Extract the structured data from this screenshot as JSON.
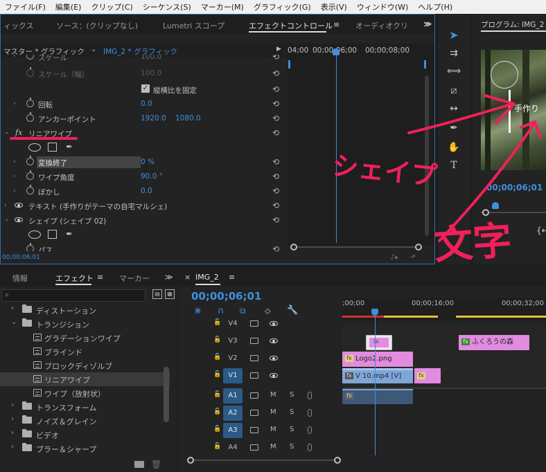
{
  "menu": [
    "ファイル(F)",
    "編集(E)",
    "クリップ(C)",
    "シーケンス(S)",
    "マーカー(M)",
    "グラフィック(G)",
    "表示(V)",
    "ウィンドウ(W)",
    "ヘルプ(H)"
  ],
  "top_panel": {
    "tabs": [
      "ィックス",
      "ソース：(クリップなし)",
      "Lumetri スコープ",
      "エフェクトコントロール",
      "オーディオクリ"
    ],
    "active_tab": "エフェクトコントロール",
    "overflow": "≫",
    "menu_icon": "≡"
  },
  "effect_controls": {
    "master_label": "マスター * グラフィック",
    "clip_label": "IMG_2 * グラフィック",
    "ruler_labels": [
      "04;00",
      "00;00;06;00",
      "00;00;08;00"
    ],
    "rows": [
      {
        "name": "スケール",
        "value": "100.0",
        "dim": true
      },
      {
        "name": "スケール（幅）",
        "value": "100.0",
        "dim": true
      },
      {
        "name": "縦横比を固定",
        "checkbox": true
      },
      {
        "name": "回転",
        "value": "0.0"
      },
      {
        "name": "アンカーポイント",
        "value": "1920.0",
        "value2": "1080.0"
      },
      {
        "name": "リニアワイプ",
        "fx": true
      },
      {
        "name": "変換終了",
        "value": "0 %",
        "highlight": true
      },
      {
        "name": "ワイプ角度",
        "value": "90.0 °"
      },
      {
        "name": "ぼかし",
        "value": "0.0"
      },
      {
        "name": "テキスト (手作りがテーマの自宅マルシェ)"
      },
      {
        "name": "シェイプ (シェイプ 02)"
      },
      {
        "name": "パス"
      }
    ],
    "timecode": "00;00;06;01"
  },
  "tools": [
    "selection-tool",
    "track-select-tool",
    "ripple-edit-tool",
    "razor-tool",
    "slip-tool",
    "pen-tool",
    "hand-tool",
    "type-tool"
  ],
  "program_monitor": {
    "title": "プログラム: IMG_2",
    "menu_icon": "≡",
    "overlay_text": "手作り",
    "timecode": "00;00;06;01"
  },
  "annotations": {
    "shape_word": "シェイプ",
    "text_word": "文字"
  },
  "effects_panel": {
    "tabs": [
      "情報",
      "エフェクト",
      "マーカー"
    ],
    "active_tab": "エフェクト",
    "menu_icon": "≡",
    "overflow": "≫",
    "tree": [
      {
        "label": "ディストーション",
        "level": 0,
        "type": "folder",
        "open": false
      },
      {
        "label": "トランジション",
        "level": 0,
        "type": "folder",
        "open": true
      },
      {
        "label": "グラデーションワイプ",
        "level": 1,
        "type": "preset"
      },
      {
        "label": "ブラインド",
        "level": 1,
        "type": "preset"
      },
      {
        "label": "ブロックディゾルブ",
        "level": 1,
        "type": "preset"
      },
      {
        "label": "リニアワイプ",
        "level": 1,
        "type": "preset",
        "selected": true
      },
      {
        "label": "ワイプ（放射状）",
        "level": 1,
        "type": "preset"
      },
      {
        "label": "トランスフォーム",
        "level": 0,
        "type": "folder",
        "open": false
      },
      {
        "label": "ノイズ＆グレイン",
        "level": 0,
        "type": "folder",
        "open": false
      },
      {
        "label": "ビデオ",
        "level": 0,
        "type": "folder",
        "open": false
      },
      {
        "label": "ブラー＆シャープ",
        "level": 0,
        "type": "folder",
        "open": false
      }
    ]
  },
  "timeline": {
    "tab_close": "×",
    "tab_label": "IMG_2",
    "menu_icon": "≡",
    "timecode": "00;00;06;01",
    "ruler_labels": [
      ";00;00",
      "00;00;16;00",
      "00;00;32;00"
    ],
    "tracks": [
      {
        "name": "V4",
        "type": "video",
        "active": false
      },
      {
        "name": "V3",
        "type": "video",
        "active": false
      },
      {
        "name": "V2",
        "type": "video",
        "active": false
      },
      {
        "name": "V1",
        "type": "video",
        "active": true
      },
      {
        "name": "A1",
        "type": "audio",
        "active": true
      },
      {
        "name": "A2",
        "type": "audio",
        "active": true
      },
      {
        "name": "A3",
        "type": "audio",
        "active": true
      },
      {
        "name": "A4",
        "type": "audio",
        "active": false
      }
    ],
    "audio_buttons": [
      "M",
      "S"
    ],
    "clips": {
      "v3_a": "fx",
      "v3_b": "ふくろうの森",
      "v2": "Logo2.png",
      "v1_a": "V 10.mp4 [V]",
      "v1_b": "fx"
    },
    "colors": {
      "clip_pink": "#e28be0",
      "clip_blue": "#7fa6d8",
      "playhead": "#3f8fe0",
      "annotation_red": "#f0205a"
    }
  }
}
